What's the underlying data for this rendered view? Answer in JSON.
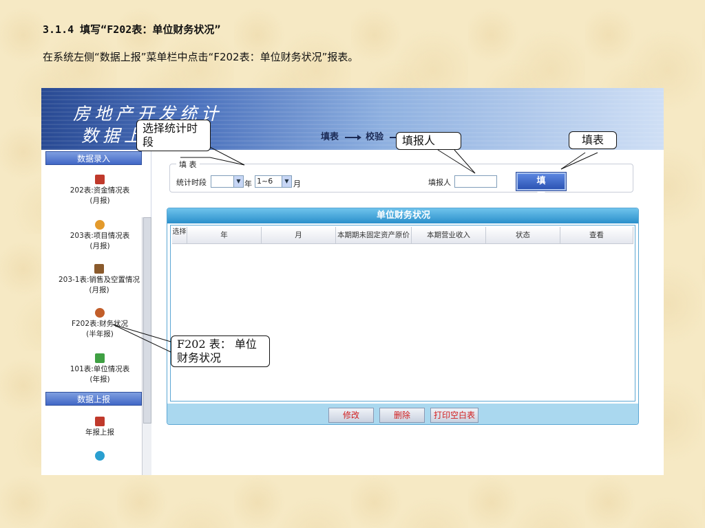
{
  "heading": "3.1.4 填写“F202表：单位财务状况”",
  "description": "在系统左侧“数据上报”菜单栏中点击“F202表：单位财务状况”报表。",
  "app": {
    "title_line1": "房地产开发统计",
    "title_line2": "数据上",
    "steps": [
      "填表",
      "校验"
    ]
  },
  "sidebar": {
    "section1": "数据录入",
    "items": [
      {
        "label": "202表:资金情况表",
        "sub": "(月报)",
        "icon": "pdf-icon",
        "color": "#c0392b"
      },
      {
        "label": "203表:项目情况表",
        "sub": "(月报)",
        "icon": "folder-icon",
        "color": "#e39a2c"
      },
      {
        "label": "203-1表:销售及空置情况",
        "sub": "(月报)",
        "icon": "bear-icon",
        "color": "#8a5a2c"
      },
      {
        "label": "F202表:财务状况",
        "sub": "(半年报)",
        "icon": "gear-icon",
        "color": "#c25e2a"
      },
      {
        "label": "101表:单位情况表",
        "sub": "(年报)",
        "icon": "check-icon",
        "color": "#3fa043"
      }
    ],
    "section2": "数据上报",
    "items2": [
      {
        "label": "年报上报",
        "icon": "upload-icon",
        "color": "#c0392b"
      },
      {
        "label": "",
        "icon": "globe-icon",
        "color": "#2a9fd0"
      }
    ]
  },
  "form": {
    "legend": "填 表",
    "period_label": "统计时段",
    "year_value": "",
    "year_unit": "年",
    "month_value": "1~6",
    "month_unit": "月",
    "reporter_label": "填报人",
    "reporter_value": "",
    "fill_button": "填 表"
  },
  "panel": {
    "title": "单位财务状况",
    "columns": [
      "选择",
      "年",
      "月",
      "本期期未固定资产原价",
      "本期营业收入",
      "状态",
      "查看"
    ],
    "buttons": [
      "修改",
      "删除",
      "打印空白表"
    ]
  },
  "callouts": {
    "period": "选择统计时段",
    "reporter": "填报人",
    "fill": "填表",
    "f202": "F202 表： 单位财务状况"
  }
}
